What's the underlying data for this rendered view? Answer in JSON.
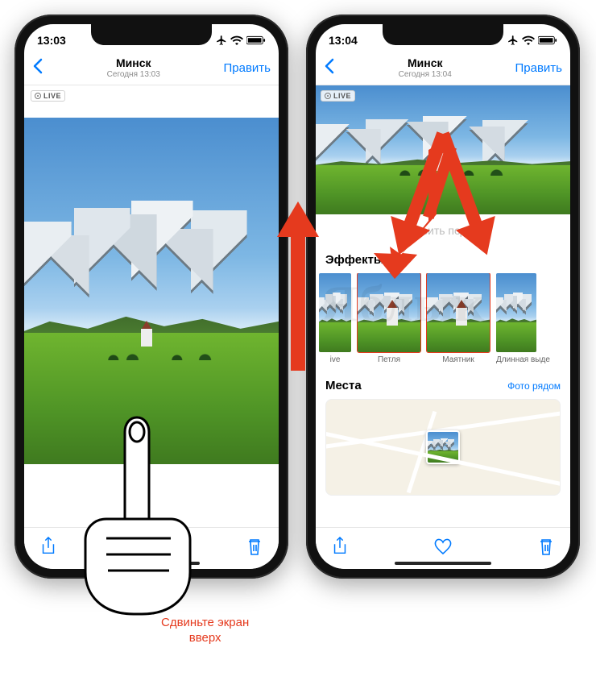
{
  "watermark": "Яблык",
  "instruction": {
    "line1": "Сдвиньте экран",
    "line2": "вверх"
  },
  "left_phone": {
    "status": {
      "time": "13:03"
    },
    "nav": {
      "title": "Минск",
      "subtitle": "Сегодня 13:03",
      "edit": "Править"
    },
    "live_badge": "LIVE"
  },
  "right_phone": {
    "status": {
      "time": "13:04"
    },
    "nav": {
      "title": "Минск",
      "subtitle": "Сегодня 13:04",
      "edit": "Править"
    },
    "live_badge": "LIVE",
    "caption_placeholder": "Добавить подпись",
    "effects": {
      "title": "Эффекты",
      "items": [
        {
          "label": "ive",
          "highlight": false,
          "partial": "left"
        },
        {
          "label": "Петля",
          "highlight": true
        },
        {
          "label": "Маятник",
          "highlight": true
        },
        {
          "label": "Длинная выде",
          "highlight": false,
          "partial": "right"
        }
      ]
    },
    "places": {
      "title": "Места",
      "nearby": "Фото рядом"
    }
  }
}
